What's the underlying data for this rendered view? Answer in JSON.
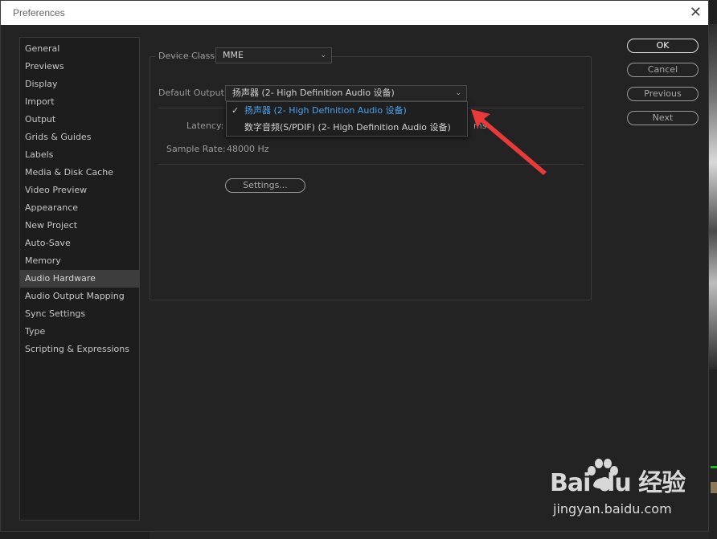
{
  "window": {
    "title": "Preferences",
    "close_glyph": "✕"
  },
  "sidebar": {
    "items": [
      {
        "label": "General"
      },
      {
        "label": "Previews"
      },
      {
        "label": "Display"
      },
      {
        "label": "Import"
      },
      {
        "label": "Output"
      },
      {
        "label": "Grids & Guides"
      },
      {
        "label": "Labels"
      },
      {
        "label": "Media & Disk Cache"
      },
      {
        "label": "Video Preview"
      },
      {
        "label": "Appearance"
      },
      {
        "label": "New Project"
      },
      {
        "label": "Auto-Save"
      },
      {
        "label": "Memory"
      },
      {
        "label": "Audio Hardware"
      },
      {
        "label": "Audio Output Mapping"
      },
      {
        "label": "Sync Settings"
      },
      {
        "label": "Type"
      },
      {
        "label": "Scripting & Expressions"
      }
    ],
    "active_label": "Audio Hardware"
  },
  "audio_hardware": {
    "device_class_label": "Device Class:",
    "device_class_value": "MME",
    "default_output_label": "Default Output:",
    "default_output_value": "扬声器 (2- High Definition Audio 设备)",
    "latency_label": "Latency:",
    "latency_unit": "ms",
    "sample_rate_label": "Sample Rate:",
    "sample_rate_value": "48000 Hz",
    "settings_button": "Settings..."
  },
  "dropdown": {
    "options": [
      {
        "label": "扬声器 (2- High Definition Audio 设备)",
        "selected": true
      },
      {
        "label": "数字音频(S/PDIF) (2- High Definition Audio 设备)",
        "selected": false
      }
    ],
    "check_glyph": "✓"
  },
  "buttons": {
    "ok": "OK",
    "cancel": "Cancel",
    "previous": "Previous",
    "next": "Next"
  },
  "watermark": {
    "logo": "Bai du 经验",
    "url": "jingyan.baidu.com"
  },
  "colors": {
    "accent_selected": "#4aa3f0",
    "annotation_arrow": "#e83a3a"
  }
}
